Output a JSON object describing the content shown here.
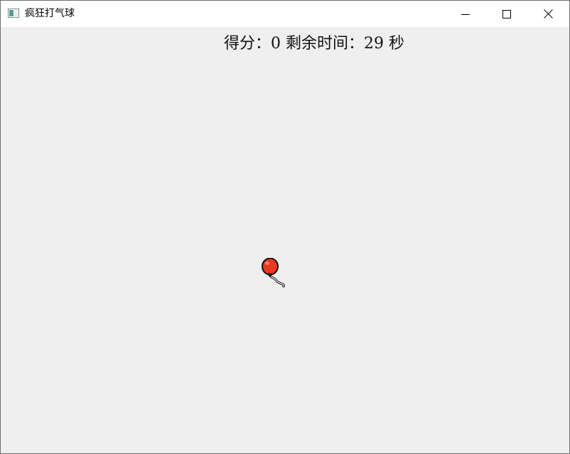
{
  "window": {
    "title": "疯狂打气球",
    "app_icon": "window-app-icon",
    "controls": {
      "minimize_icon": "minimize-icon",
      "maximize_icon": "maximize-icon",
      "close_icon": "close-icon"
    }
  },
  "hud": {
    "score_label": "得分：",
    "score": "0",
    "time_label": " 剩余时间：",
    "time_remaining": "29",
    "time_unit": " 秒"
  },
  "balloon": {
    "icon": "balloon-icon",
    "color": "#e8391f"
  },
  "colors": {
    "background": "#efefef",
    "titlebar": "#ffffff"
  }
}
